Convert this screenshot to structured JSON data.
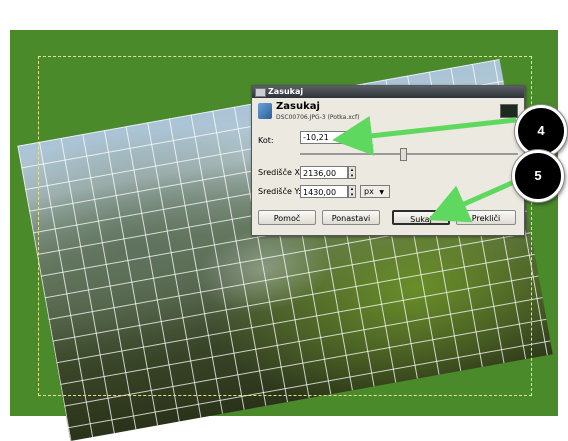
{
  "dialog": {
    "window_title": "Zasukaj",
    "header_title": "Zasukaj",
    "header_subtitle": "DSC00706.JPG-3 (Potka.xcf)",
    "angle_label": "Kot:",
    "angle_value": "-10,21",
    "center_x_label": "Središče X:",
    "center_x_value": "2136,00",
    "center_y_label": "Središče Y:",
    "center_y_value": "1430,00",
    "unit": "px",
    "buttons": {
      "help": "Pomoč",
      "reset": "Ponastavi",
      "rotate": "Sukaj",
      "cancel": "Prekliči"
    }
  },
  "callouts": {
    "step4": "4",
    "step5": "5"
  },
  "colors": {
    "background_green": "#4a8a2b",
    "arrow_green": "#5ed85e",
    "selection_dash": "#e5e58a"
  },
  "icons": [
    "rotate-tool-icon",
    "window-icon",
    "spin-arrows-icon",
    "dropdown-arrow-icon"
  ]
}
